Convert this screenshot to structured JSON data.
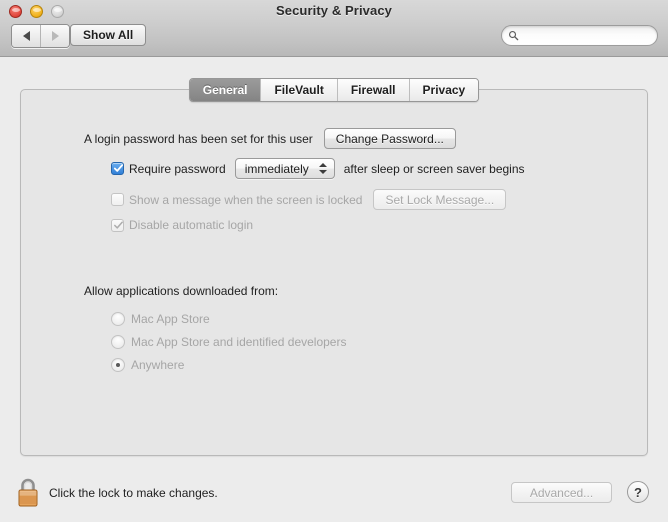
{
  "window": {
    "title": "Security & Privacy",
    "traffic_lights": [
      {
        "name": "close",
        "color": "#e0443a",
        "enabled": true
      },
      {
        "name": "minimize",
        "color": "#f0b018",
        "enabled": true
      },
      {
        "name": "zoom",
        "color": "#d4d4d4",
        "enabled": false
      }
    ]
  },
  "toolbar": {
    "back_icon": "triangle-left-icon",
    "forward_icon": "triangle-right-icon",
    "back_enabled": true,
    "forward_enabled": false,
    "show_all_label": "Show All",
    "search": {
      "icon": "search-icon",
      "value": "",
      "placeholder": ""
    }
  },
  "tabs": [
    {
      "label": "General",
      "selected": true
    },
    {
      "label": "FileVault",
      "selected": false
    },
    {
      "label": "Firewall",
      "selected": false
    },
    {
      "label": "Privacy",
      "selected": false
    }
  ],
  "general": {
    "login_password_status": "A login password has been set for this user",
    "change_password_label": "Change Password...",
    "require_password": {
      "checked": true,
      "enabled": true,
      "label_before": "Require password",
      "delay_value": "immediately",
      "label_after": "after sleep or screen saver begins"
    },
    "show_message": {
      "checked": false,
      "enabled": false,
      "label": "Show a message when the screen is locked",
      "button_label": "Set Lock Message...",
      "button_enabled": false
    },
    "disable_automatic_login": {
      "checked": true,
      "enabled": false,
      "label": "Disable automatic login"
    },
    "gatekeeper": {
      "title": "Allow applications downloaded from:",
      "options": [
        {
          "label": "Mac App Store",
          "selected": false
        },
        {
          "label": "Mac App Store and identified developers",
          "selected": false
        },
        {
          "label": "Anywhere",
          "selected": true
        }
      ],
      "enabled": false
    }
  },
  "footer": {
    "lock_icon": "lock-closed-icon",
    "lock_message": "Click the lock to make changes.",
    "advanced_label": "Advanced...",
    "advanced_enabled": false,
    "help_label": "?"
  },
  "colors": {
    "accent_checkbox": "#317fd6",
    "window_background": "#ececec",
    "content_background": "#e6e6e6",
    "tab_selected_background": "#8d8d8d",
    "lock_body": "#e08c3a",
    "disabled_text": "#a6a6a6"
  }
}
